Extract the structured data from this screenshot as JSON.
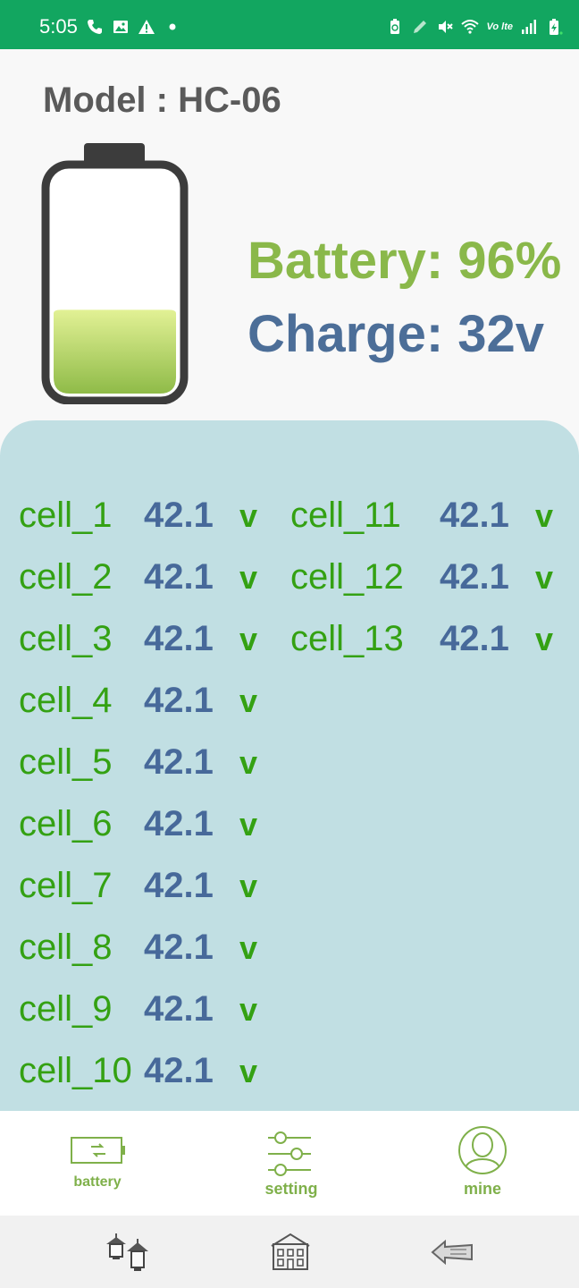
{
  "status_bar": {
    "time": "5:05",
    "left_icons": [
      "phone-icon",
      "image-icon",
      "warning-icon",
      "dot-icon"
    ],
    "right_icons": [
      "battery-saver-icon",
      "pen-icon",
      "mute-icon",
      "wifi-icon",
      "volte-icon",
      "signal-icon",
      "battery-icon"
    ],
    "volte_label": "Vo lte"
  },
  "header": {
    "model_label": "Model :",
    "model_value": "HC-06"
  },
  "battery": {
    "level_percent": 96,
    "battery_text": "Battery: 96%",
    "charge_text": "Charge: 32v",
    "colors": {
      "battery": "#8ab84a",
      "charge": "#4c6e98",
      "outline": "#3c3c3c"
    }
  },
  "cells": [
    {
      "name": "cell_1",
      "value": "42.1",
      "unit": "v"
    },
    {
      "name": "cell_2",
      "value": "42.1",
      "unit": "v"
    },
    {
      "name": "cell_3",
      "value": "42.1",
      "unit": "v"
    },
    {
      "name": "cell_4",
      "value": "42.1",
      "unit": "v"
    },
    {
      "name": "cell_5",
      "value": "42.1",
      "unit": "v"
    },
    {
      "name": "cell_6",
      "value": "42.1",
      "unit": "v"
    },
    {
      "name": "cell_7",
      "value": "42.1",
      "unit": "v"
    },
    {
      "name": "cell_8",
      "value": "42.1",
      "unit": "v"
    },
    {
      "name": "cell_9",
      "value": "42.1",
      "unit": "v"
    },
    {
      "name": "cell_10",
      "value": "42.1",
      "unit": "v"
    },
    {
      "name": "cell_11",
      "value": "42.1",
      "unit": "v"
    },
    {
      "name": "cell_12",
      "value": "42.1",
      "unit": "v"
    },
    {
      "name": "cell_13",
      "value": "42.1",
      "unit": "v"
    }
  ],
  "nav": {
    "items": [
      {
        "label": "battery",
        "icon": "battery-outline-icon"
      },
      {
        "label": "setting",
        "icon": "sliders-icon"
      },
      {
        "label": "mine",
        "icon": "user-circle-icon"
      }
    ],
    "accent": "#7fb04a"
  },
  "system_nav": {
    "icons": [
      "lanterns-icon",
      "house-icon",
      "back-arrow-icon"
    ]
  }
}
